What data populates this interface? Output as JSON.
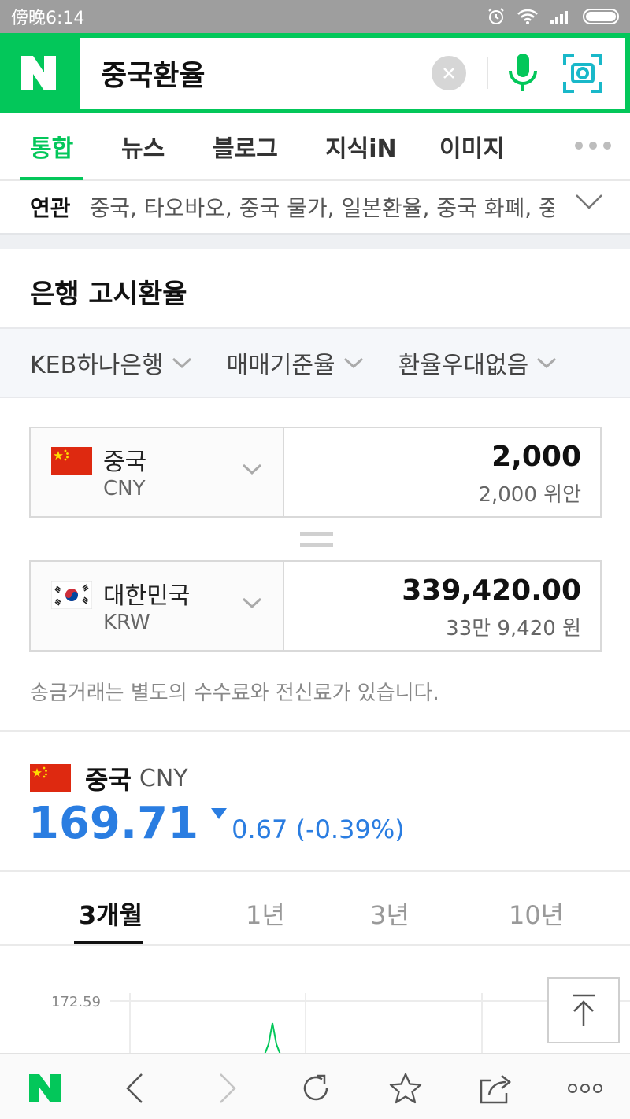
{
  "status_bar": {
    "time": "傍晚6:14"
  },
  "search": {
    "query": "중국환율"
  },
  "tabs": [
    {
      "label": "통합"
    },
    {
      "label": "뉴스"
    },
    {
      "label": "블로그"
    },
    {
      "label": "지식iN"
    },
    {
      "label": "이미지"
    }
  ],
  "related": {
    "label": "연관",
    "text": "중국, 타오바오, 중국 물가, 일본환율, 중국 화폐, 중국"
  },
  "bank_rate": {
    "title": "은행 고시환율",
    "filters": [
      "KEB하나은행",
      "매매기준율",
      "환율우대없음"
    ],
    "from": {
      "country": "중국",
      "code": "CNY",
      "amount": "2,000",
      "amount_text": "2,000 위안"
    },
    "to": {
      "country": "대한민국",
      "code": "KRW",
      "amount": "339,420.00",
      "amount_text": "33만 9,420 원"
    },
    "notice": "송금거래는 별도의 수수료와 전신료가 있습니다."
  },
  "rate_summary": {
    "country": "중국",
    "code": "CNY",
    "rate": "169.71",
    "change": "0.67 (-0.39%)",
    "direction": "down"
  },
  "periods": [
    "3개월",
    "1년",
    "3년",
    "10년"
  ],
  "chart_data": {
    "type": "line",
    "y_tick_labels": [
      "172.59"
    ],
    "grid": true
  },
  "colors": {
    "brand_green": "#03c75a",
    "rate_blue": "#2a7de1"
  }
}
